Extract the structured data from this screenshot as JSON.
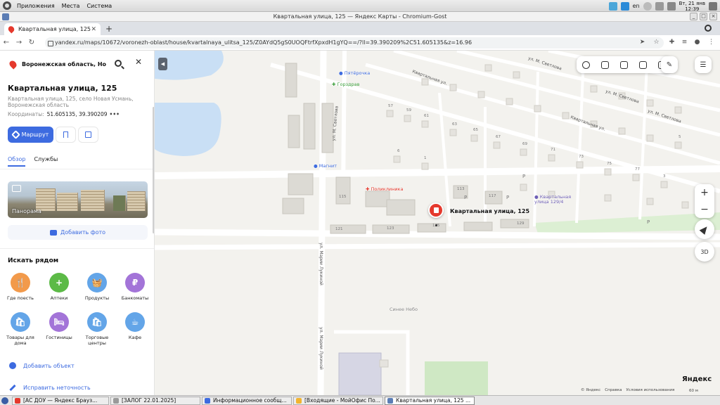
{
  "os": {
    "menu": [
      "Приложения",
      "Места",
      "Система"
    ],
    "lang": "en",
    "clock_line1": "Вт, 21 янв",
    "clock_line2": "12:39"
  },
  "window": {
    "title": "Квартальная улица, 125 — Яндекс Карты - Chromium-Gost"
  },
  "browser": {
    "tab_title": "Квартальная улица, 125",
    "url": "yandex.ru/maps/10672/voronezh-oblast/house/kvartalnaya_ulitsa_125/Z0AYdQ5gS0UOQFtrfXpxdH1gYQ==/?ll=39.390209%2C51.605135&z=16.96"
  },
  "sidebar": {
    "search_value": "Воронежская область, Новоусмань",
    "place_title": "Квартальная улица, 125",
    "place_address": "Квартальная улица, 125, село Новая Усмань, Воронежская область",
    "coords_label": "Координаты:",
    "coords_value": "51.605135, 39.390209",
    "coords_more": "•••",
    "route_label": "Маршрут",
    "tabs": [
      "Обзор",
      "Службы"
    ],
    "panorama_label": "Панорама",
    "add_photo_label": "Добавить фото",
    "nearby_title": "Искать рядом",
    "categories": [
      {
        "label": "Где поесть",
        "icon": "fork-knife-icon",
        "color": "#f29a4b",
        "glyph": "🍴"
      },
      {
        "label": "Аптеки",
        "icon": "pharmacy-icon",
        "color": "#5cba47",
        "glyph": "+"
      },
      {
        "label": "Продукты",
        "icon": "basket-icon",
        "color": "#63a5e8",
        "glyph": "🧺"
      },
      {
        "label": "Банкоматы",
        "icon": "ruble-icon",
        "color": "#a374d8",
        "glyph": "₽"
      },
      {
        "label": "Товары для дома",
        "icon": "bag-icon",
        "color": "#63a5e8",
        "glyph": "🛍"
      },
      {
        "label": "Гостиницы",
        "icon": "bed-icon",
        "color": "#a374d8",
        "glyph": "🛏"
      },
      {
        "label": "Торговые центры",
        "icon": "shopping-bag-icon",
        "color": "#63a5e8",
        "glyph": "🛍"
      },
      {
        "label": "Кафе",
        "icon": "cup-icon",
        "color": "#63a5e8",
        "glyph": "☕"
      }
    ],
    "actions": [
      "Добавить объект",
      "Исправить неточность"
    ]
  },
  "map": {
    "marker_label": "Квартальная улица, 125",
    "pois": [
      {
        "name": "Пятёрочка",
        "color": "#3d6be0"
      },
      {
        "name": "Горздрав",
        "color": "#3a9e3a"
      },
      {
        "name": "Магнит",
        "color": "#3d6be0"
      },
      {
        "name": "Поликлиника",
        "color": "#e5392d"
      },
      {
        "name": "Квартальная улица 129/4",
        "color": "#6e5fb5"
      },
      {
        "name": "Синее Небо",
        "color": "#888888"
      }
    ],
    "streets": [
      "Квартальная ул.",
      "Квартальная ул.",
      "ул. М. Светлова",
      "ул. М. Светлова",
      "ул. М. Светлова",
      "ул. Марии Лукиной",
      "ул. Марии Лукиной",
      "ул. М. Светлова"
    ],
    "house_numbers": [
      "121",
      "123",
      "125",
      "129",
      "115",
      "113",
      "117",
      "57",
      "59",
      "61",
      "63",
      "65",
      "67",
      "69",
      "71",
      "73",
      "75",
      "77",
      "6",
      "1",
      "3",
      "5",
      "Р",
      "Р",
      "Р",
      "Р"
    ],
    "controls": {
      "plus": "+",
      "minus": "−",
      "threed": "3D"
    },
    "copyright": [
      "© Яндекс",
      "Справка",
      "Условия использования"
    ],
    "scale_label": "60 м",
    "logo": "Яндекс"
  },
  "taskbar": [
    {
      "label": "[АС ДОУ — Яндекс Брауз...",
      "color": "#e5392d"
    },
    {
      "label": "[ЗАЛОГ 22.01.2025]",
      "color": "#9a9a9a"
    },
    {
      "label": "Информационное сообщ...",
      "color": "#3d6be0"
    },
    {
      "label": "[Входящие - МойОфис По...",
      "color": "#f2b431"
    },
    {
      "label": "Квартальная улица, 125 ...",
      "color": "#5b7db5"
    }
  ]
}
